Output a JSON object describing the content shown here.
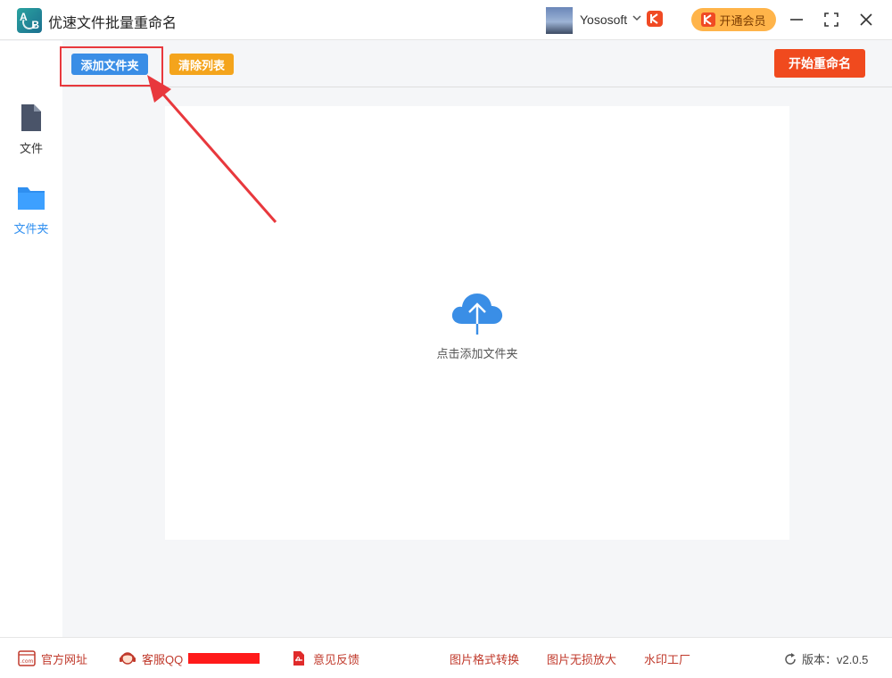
{
  "app": {
    "title": "优速文件批量重命名",
    "logo_letters": [
      "A",
      "B"
    ]
  },
  "user": {
    "name": "Yososoft"
  },
  "header": {
    "vip_button": "开通会员"
  },
  "sidebar": {
    "items": [
      {
        "label": "文件",
        "icon": "file-icon",
        "active": false
      },
      {
        "label": "文件夹",
        "icon": "folder-icon",
        "active": true
      }
    ]
  },
  "toolbar": {
    "add_folder": "添加文件夹",
    "clear_list": "清除列表",
    "start_rename": "开始重命名"
  },
  "main": {
    "drop_hint": "点击添加文件夹",
    "icon": "cloud-upload-icon"
  },
  "footer": {
    "website": "官方网址",
    "website_icon_text": ".com",
    "service_qq": "客服QQ",
    "feedback": "意见反馈",
    "image_convert": "图片格式转换",
    "image_enlarge": "图片无损放大",
    "watermark": "水印工厂",
    "version": "版本：v2.0.5"
  },
  "colors": {
    "primary_blue": "#3a8ee6",
    "clear_orange": "#f4a41c",
    "start_red": "#f04a1e",
    "vip_gold": "#ffb44a",
    "annotation_red": "#e8383d",
    "footer_link_red": "#c0392b"
  }
}
